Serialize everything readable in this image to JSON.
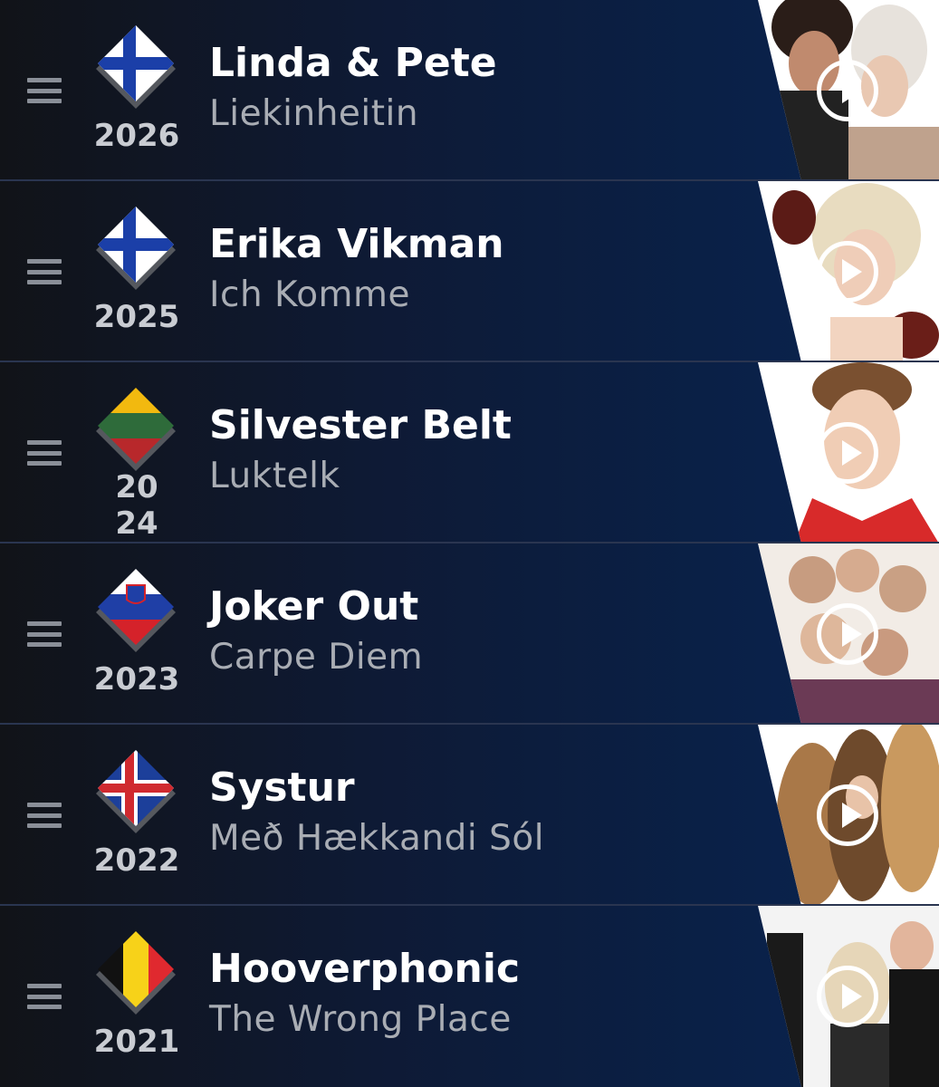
{
  "entries": [
    {
      "year": "2026",
      "artist": "Linda & Pete",
      "song": "Liekinheitin",
      "flag": "finland-flag-icon",
      "photo": "artist-photo"
    },
    {
      "year": "2025",
      "artist": "Erika Vikman",
      "song": "Ich Komme",
      "flag": "finland-flag-icon",
      "photo": "artist-photo"
    },
    {
      "year": "2024",
      "artist": "Silvester Belt",
      "song": "Luktelk",
      "flag": "lithuania-flag-icon",
      "photo": "artist-photo"
    },
    {
      "year": "2023",
      "artist": "Joker Out",
      "song": "Carpe Diem",
      "flag": "slovenia-flag-icon",
      "photo": "artist-photo"
    },
    {
      "year": "2022",
      "artist": "Systur",
      "song": "Með Hækkandi Sól",
      "flag": "iceland-flag-icon",
      "photo": "artist-photo"
    },
    {
      "year": "2021",
      "artist": "Hooverphonic",
      "song": "The Wrong Place",
      "flag": "belgium-flag-icon",
      "photo": "artist-photo"
    }
  ],
  "colors": {
    "finland_blue": "#1b3fa8",
    "lithuania_yellow": "#f2b90f",
    "lithuania_green": "#2e6b3a",
    "lithuania_red": "#b8282b",
    "slovenia_blue": "#1f3fa6",
    "slovenia_red": "#d5222a",
    "iceland_blue": "#1c3f9a",
    "iceland_red": "#d02a2f",
    "belgium_black": "#111111",
    "belgium_yellow": "#f7d219",
    "belgium_red": "#e0292f"
  }
}
